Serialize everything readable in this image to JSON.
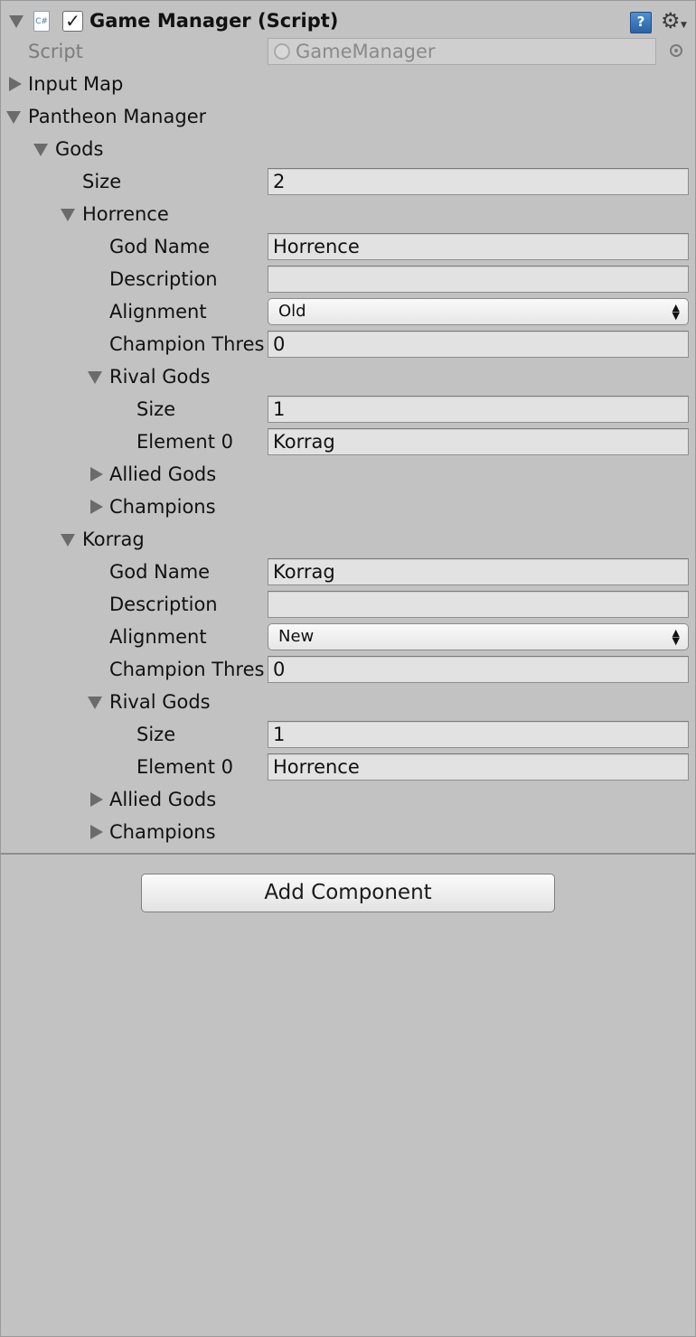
{
  "component": {
    "title": "Game Manager (Script)",
    "enabled": true,
    "script_label": "Script",
    "script_value": "GameManager",
    "icons": [
      "cs-script-icon",
      "help-icon",
      "gear-icon"
    ]
  },
  "input_map": {
    "label": "Input Map"
  },
  "pantheon": {
    "label": "Pantheon Manager",
    "gods_label": "Gods",
    "size_label": "Size",
    "size_value": "2",
    "gods": [
      {
        "header": "Horrence",
        "god_name_label": "God Name",
        "god_name": "Horrence",
        "description_label": "Description",
        "description": "",
        "alignment_label": "Alignment",
        "alignment": "Old",
        "threshold_label": "Champion Thres",
        "threshold": "0",
        "rivals_label": "Rival Gods",
        "rivals_size_label": "Size",
        "rivals_size": "1",
        "element0_label": "Element 0",
        "element0": "Korrag",
        "allied_label": "Allied Gods",
        "champions_label": "Champions"
      },
      {
        "header": "Korrag",
        "god_name_label": "God Name",
        "god_name": "Korrag",
        "description_label": "Description",
        "description": "",
        "alignment_label": "Alignment",
        "alignment": "New",
        "threshold_label": "Champion Thres",
        "threshold": "0",
        "rivals_label": "Rival Gods",
        "rivals_size_label": "Size",
        "rivals_size": "1",
        "element0_label": "Element 0",
        "element0": "Horrence",
        "allied_label": "Allied Gods",
        "champions_label": "Champions"
      }
    ]
  },
  "add_component_label": "Add Component"
}
